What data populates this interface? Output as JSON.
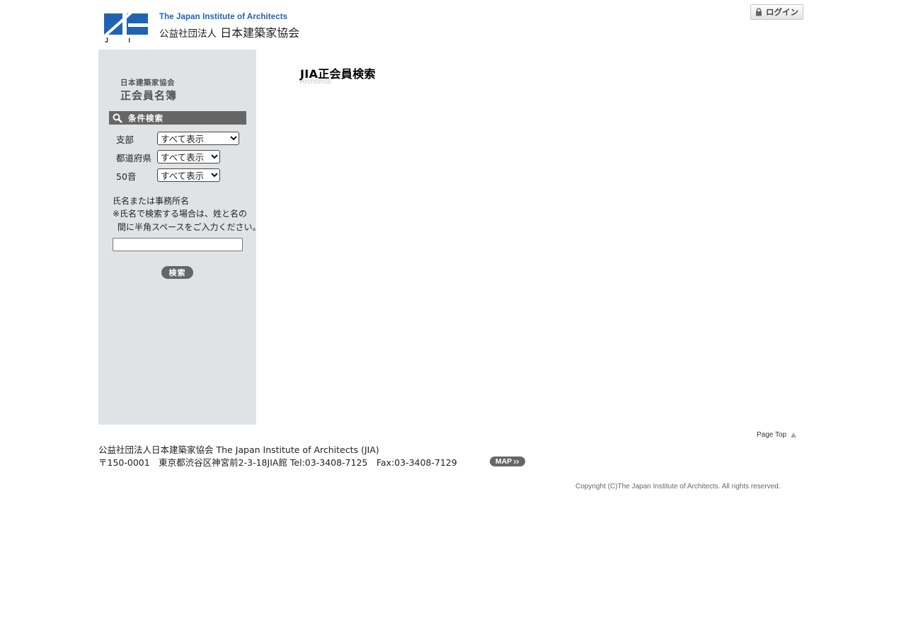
{
  "header": {
    "logo_letters": "J I A",
    "org_name_en": "The Japan Institute of Architects",
    "org_type": "公益社団法人",
    "org_name_ja": "日本建築家協会",
    "login_label": "ログイン",
    "brand_color": "#1f63b5"
  },
  "sidebar": {
    "subtitle": "日本建築家協会",
    "title": "正会員名簿",
    "search_bar_label": "条件検索",
    "filters": [
      {
        "label": "支部",
        "value": "すべて表示"
      },
      {
        "label": "都道府県",
        "value": "すべて表示"
      },
      {
        "label": "50音",
        "value": "すべて表示"
      }
    ],
    "name_label": "氏名または事務所名",
    "note_line1": "※氏名で検索する場合は、姓と名の",
    "note_line2": "間に半角スペースをご入力ください。",
    "name_input_value": "",
    "search_button": "検索"
  },
  "main": {
    "title": "JIA正会員検索",
    "subtitle": "Architects"
  },
  "footer": {
    "page_top": "Page Top",
    "line1": "公益社団法人日本建築家協会 The Japan Institute of Architects (JIA)",
    "line2": "〒150-0001　東京都渋谷区神宮前2-3-18JIA館 Tel:03-3408-7125　Fax:03-3408-7129",
    "map_label": "MAP",
    "copyright": "Copyright (C)The Japan Institute of Architects. All rights reserved."
  }
}
